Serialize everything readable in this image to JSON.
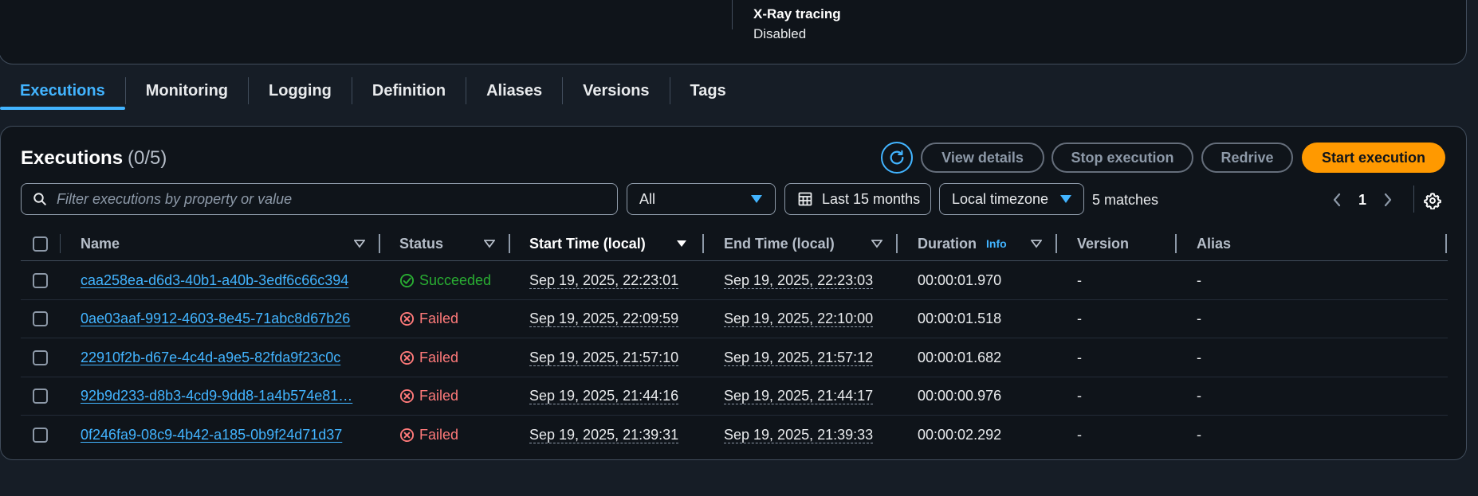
{
  "header": {
    "xray_label": "X-Ray tracing",
    "xray_value": "Disabled"
  },
  "tabs": [
    {
      "label": "Executions",
      "active": true
    },
    {
      "label": "Monitoring"
    },
    {
      "label": "Logging"
    },
    {
      "label": "Definition"
    },
    {
      "label": "Aliases"
    },
    {
      "label": "Versions"
    },
    {
      "label": "Tags"
    }
  ],
  "panel": {
    "title": "Executions",
    "count": "(0/5)",
    "buttons": {
      "view_details": "View details",
      "stop_execution": "Stop execution",
      "redrive": "Redrive",
      "start_execution": "Start execution"
    },
    "search_placeholder": "Filter executions by property or value",
    "status_filter": "All",
    "date_range": "Last 15 months",
    "timezone": "Local timezone",
    "matches": "5 matches",
    "current_page": "1"
  },
  "table": {
    "columns": {
      "name": "Name",
      "status": "Status",
      "start_time": "Start Time (local)",
      "end_time": "End Time (local)",
      "duration": "Duration",
      "duration_info": "Info",
      "version": "Version",
      "alias": "Alias"
    },
    "rows": [
      {
        "name": "caa258ea-d6d3-40b1-a40b-3edf6c66c394",
        "status": "Succeeded",
        "start": "Sep 19, 2025, 22:23:01",
        "end": "Sep 19, 2025, 22:23:03",
        "duration": "00:00:01.970",
        "version": "-",
        "alias": "-"
      },
      {
        "name": "0ae03aaf-9912-4603-8e45-71abc8d67b26",
        "status": "Failed",
        "start": "Sep 19, 2025, 22:09:59",
        "end": "Sep 19, 2025, 22:10:00",
        "duration": "00:00:01.518",
        "version": "-",
        "alias": "-"
      },
      {
        "name": "22910f2b-d67e-4c4d-a9e5-82fda9f23c0c",
        "status": "Failed",
        "start": "Sep 19, 2025, 21:57:10",
        "end": "Sep 19, 2025, 21:57:12",
        "duration": "00:00:01.682",
        "version": "-",
        "alias": "-"
      },
      {
        "name": "92b9d233-d8b3-4cd9-9dd8-1a4b574e81…",
        "status": "Failed",
        "start": "Sep 19, 2025, 21:44:16",
        "end": "Sep 19, 2025, 21:44:17",
        "duration": "00:00:00.976",
        "version": "-",
        "alias": "-"
      },
      {
        "name": "0f246fa9-08c9-4b42-a185-0b9f24d71d37",
        "status": "Failed",
        "start": "Sep 19, 2025, 21:39:31",
        "end": "Sep 19, 2025, 21:39:33",
        "duration": "00:00:02.292",
        "version": "-",
        "alias": "-"
      }
    ]
  },
  "colors": {
    "accent": "#42b4ff",
    "primary_button": "#ff9900",
    "success": "#29ad32",
    "error": "#ff7a7a"
  }
}
